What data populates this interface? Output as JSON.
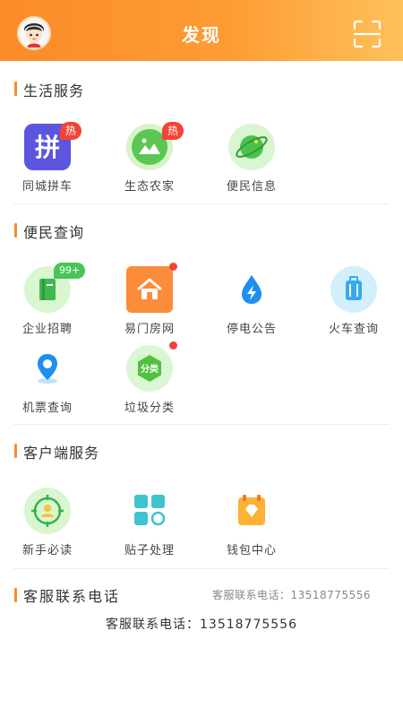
{
  "header": {
    "title": "发现"
  },
  "colors": {
    "accent": "#fb8b2a",
    "hot_badge": "#f44336",
    "count_badge": "#47c45a"
  },
  "sections": [
    {
      "title": "生活服务",
      "items": [
        {
          "label": "同城拼车",
          "icon": "pin-carpool-icon",
          "badge": "热"
        },
        {
          "label": "生态农家",
          "icon": "mountain-landscape-icon",
          "badge": "热"
        },
        {
          "label": "便民信息",
          "icon": "planet-icon"
        }
      ]
    },
    {
      "title": "便民查询",
      "items": [
        {
          "label": "企业招聘",
          "icon": "book-icon",
          "badge": "99+"
        },
        {
          "label": "易门房网",
          "icon": "house-icon",
          "dot": true
        },
        {
          "label": "停电公告",
          "icon": "lightning-drop-icon"
        },
        {
          "label": "火车查询",
          "icon": "suitcase-icon"
        },
        {
          "label": "机票查询",
          "icon": "location-pin-icon"
        },
        {
          "label": "垃圾分类",
          "icon": "recycle-hexagon-icon",
          "tag": "分类",
          "dot": true
        }
      ]
    },
    {
      "title": "客户端服务",
      "items": [
        {
          "label": "新手必读",
          "icon": "target-person-icon"
        },
        {
          "label": "贴子处理",
          "icon": "grid-apps-icon"
        },
        {
          "label": "钱包中心",
          "icon": "wallet-diamond-icon"
        }
      ]
    }
  ],
  "service": {
    "label": "客服联系电话",
    "phone_right": "客服联系电话：13518775556",
    "phone_center": "客服联系电话：13518775556"
  }
}
